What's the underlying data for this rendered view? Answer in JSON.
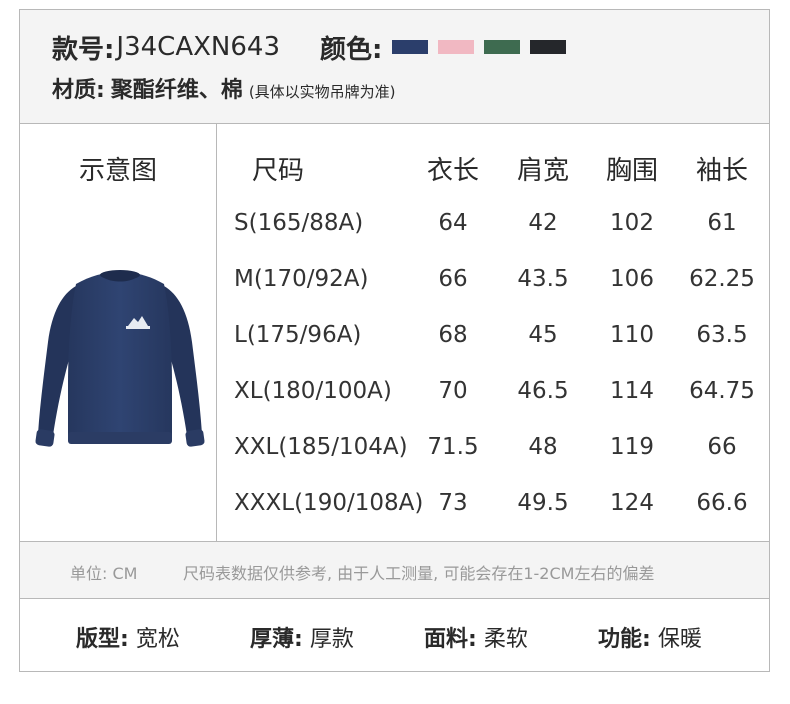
{
  "header": {
    "style_label": "款号:",
    "style_code": "J34CAXN643",
    "color_label": "颜色:",
    "colors": [
      "#2b3e6b",
      "#f1b8c2",
      "#3e6b50",
      "#25272b"
    ],
    "material_label": "材质:",
    "material_value": "聚酯纤维、棉",
    "material_note": "(具体以实物吊牌为准)"
  },
  "diagram": {
    "title": "示意图"
  },
  "table": {
    "columns": [
      "尺码",
      "衣长",
      "肩宽",
      "胸围",
      "袖长"
    ],
    "rows": [
      [
        "S(165/88A)",
        "64",
        "42",
        "102",
        "61"
      ],
      [
        "M(170/92A)",
        "66",
        "43.5",
        "106",
        "62.25"
      ],
      [
        "L(175/96A)",
        "68",
        "45",
        "110",
        "63.5"
      ],
      [
        "XL(180/100A)",
        "70",
        "46.5",
        "114",
        "64.75"
      ],
      [
        "XXL(185/104A)",
        "71.5",
        "48",
        "119",
        "66"
      ],
      [
        "XXXL(190/108A)",
        "73",
        "49.5",
        "124",
        "66.6"
      ]
    ]
  },
  "footer": {
    "unit": "单位: CM",
    "disclaimer": "尺码表数据仅供参考, 由于人工测量, 可能会存在1-2CM左右的偏差"
  },
  "attributes": [
    {
      "label": "版型:",
      "value": "宽松"
    },
    {
      "label": "厚薄:",
      "value": "厚款"
    },
    {
      "label": "面料:",
      "value": "柔软"
    },
    {
      "label": "功能:",
      "value": "保暖"
    }
  ]
}
